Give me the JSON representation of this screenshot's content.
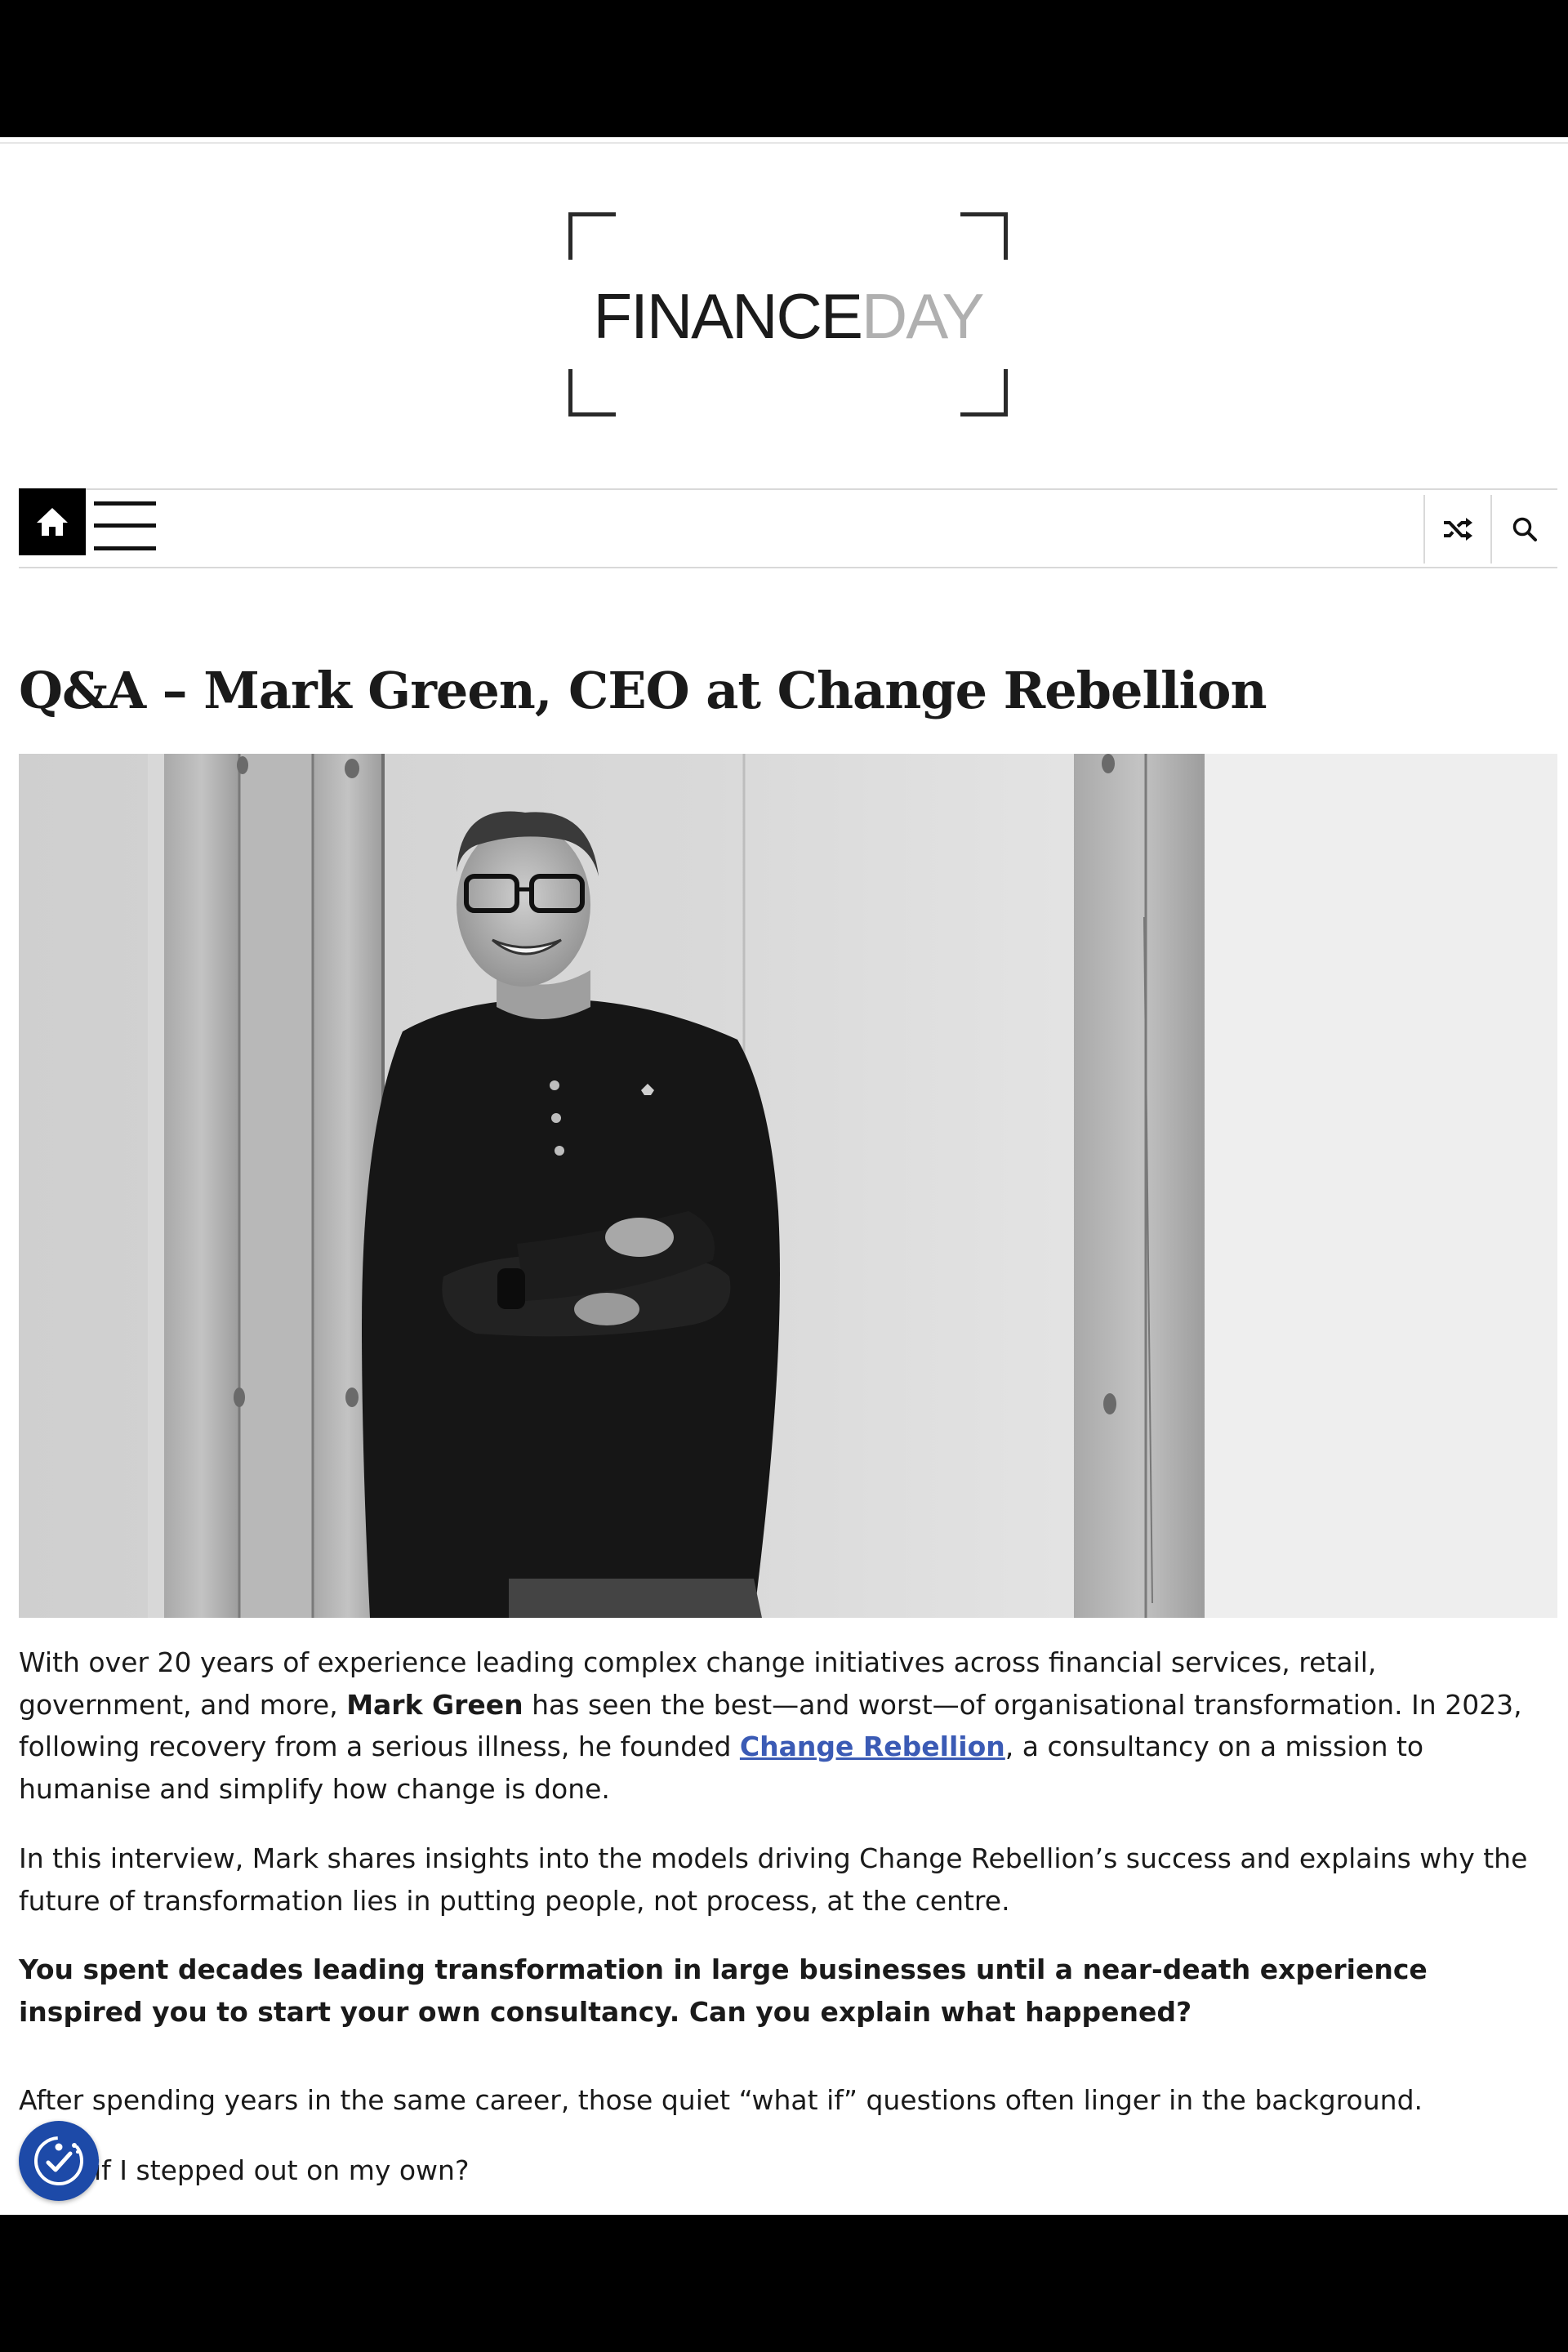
{
  "site": {
    "logo_part1": "FINANCE",
    "logo_part2": "DAY"
  },
  "nav": {
    "home_icon": "home-icon",
    "menu_icon": "hamburger-menu-icon",
    "shuffle_icon": "shuffle-icon",
    "search_icon": "search-icon"
  },
  "article": {
    "title": "Q&A – Mark Green, CEO at Change Rebellion",
    "hero_image": "black-and-white portrait photo",
    "p1_a": "With over 20 years of experience leading complex change initiatives across financial services, retail, government, and more, ",
    "p1_bold": "Mark Green",
    "p1_b": " has seen the best—and worst—of organisational transformation. In 2023, following recovery from a serious illness, he founded ",
    "p1_link": "Change Rebellion",
    "p1_c": ", a consultancy on a mission to humanise and simplify how change is done.",
    "p2": "In this interview, Mark shares insights into the models driving Change Rebellion’s success and explains why the future of transformation lies in putting people, not process, at the centre.",
    "q1": "You spent decades leading transformation in large businesses until a near-death experience inspired you to start your own consultancy. Can you explain what happened?",
    "a1_p1": "After spending years in the same career, those quiet “what if” questions often linger in the background.",
    "a1_p2": "if I stepped out on my own?"
  },
  "accessibility": {
    "icon": "accessibility-icon"
  },
  "colors": {
    "link": "#3b5bb5",
    "accessibility_button": "#1d4aa8",
    "logo_dark": "#1b1b1b",
    "logo_light": "#b0b0b0"
  }
}
